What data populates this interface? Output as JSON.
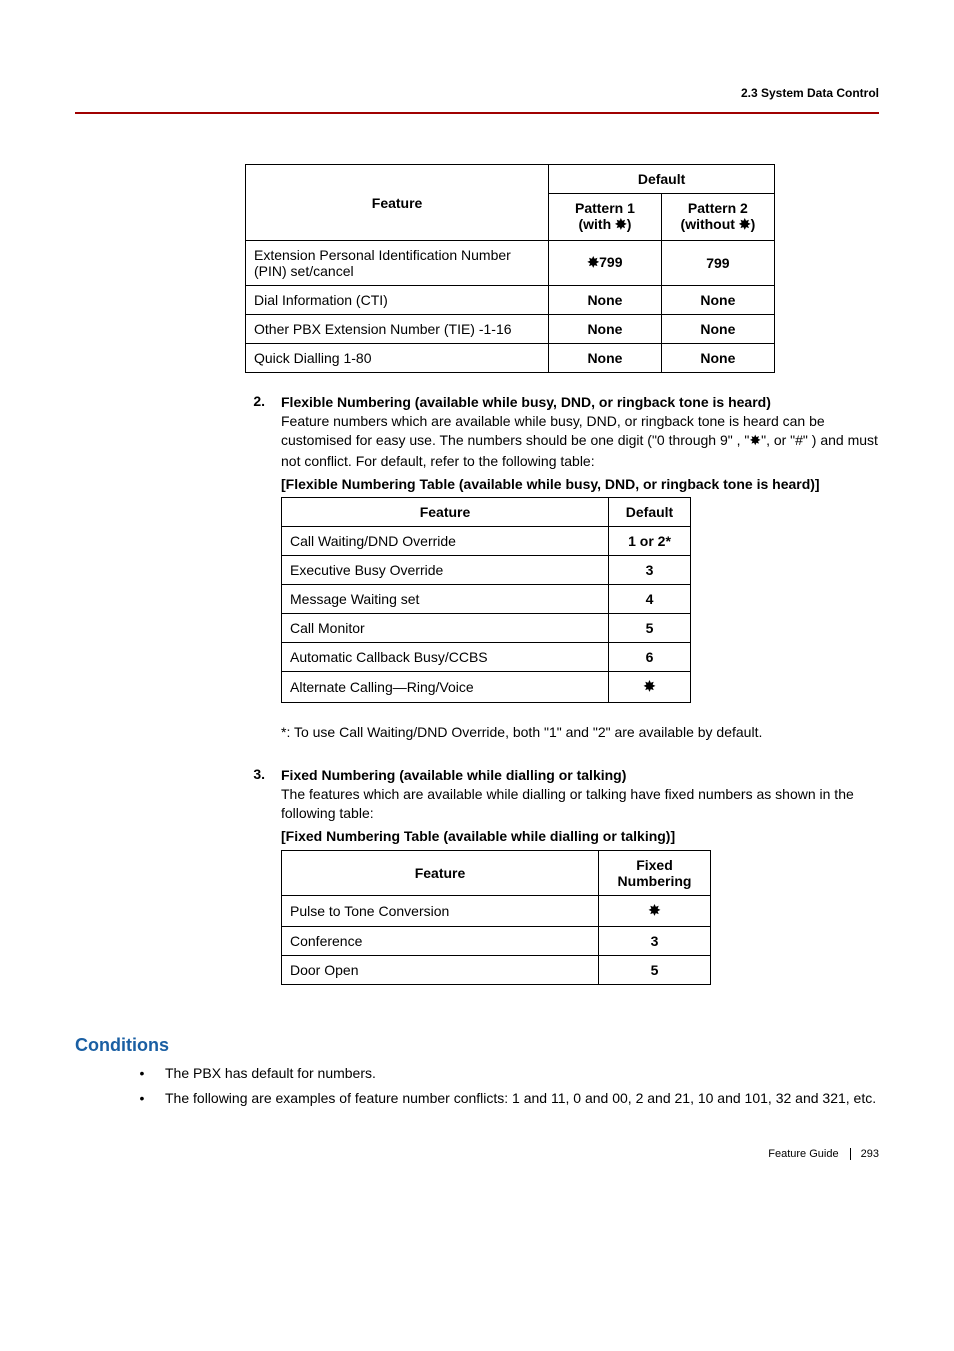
{
  "header": {
    "section": "2.3 System Data Control"
  },
  "table1": {
    "headers": {
      "feature": "Feature",
      "default": "Default",
      "pattern1_line1": "Pattern 1",
      "pattern1_line2": "(with ",
      "pattern1_line3": ")",
      "pattern2_line1": "Pattern 2",
      "pattern2_line2": "(without ",
      "pattern2_line3": ")"
    },
    "rows": [
      {
        "feature": "Extension Personal Identification Number (PIN) set/cancel",
        "p1": "799",
        "p1_star": true,
        "p2": "799"
      },
      {
        "feature": "Dial Information (CTI)",
        "p1": "None",
        "p1_star": false,
        "p2": "None"
      },
      {
        "feature": "Other PBX Extension Number (TIE) -1-16",
        "p1": "None",
        "p1_star": false,
        "p2": "None"
      },
      {
        "feature": "Quick Dialling 1-80",
        "p1": "None",
        "p1_star": false,
        "p2": "None"
      }
    ]
  },
  "item2": {
    "num": "2.",
    "title": "Flexible Numbering (available while busy, DND, or ringback tone is heard)",
    "body1": "Feature numbers which are available while busy, DND, or ringback tone is heard can be customised for easy use. The numbers should be one digit (\"0 through 9\" , \"",
    "body2": "\", or \"#\" ) and must not conflict. For default, refer to the following table:",
    "table_title": "[Flexible Numbering Table (available while busy, DND, or ringback tone is heard)]",
    "headers": {
      "feature": "Feature",
      "default": "Default"
    },
    "rows": [
      {
        "feature": "Call Waiting/DND Override",
        "default": "1 or 2*"
      },
      {
        "feature": "Executive Busy Override",
        "default": "3"
      },
      {
        "feature": "Message Waiting set",
        "default": "4"
      },
      {
        "feature": "Call Monitor",
        "default": "5"
      },
      {
        "feature": "Automatic Callback Busy/CCBS",
        "default": "6"
      },
      {
        "feature": "Alternate Calling—Ring/Voice",
        "default": "★",
        "is_star": true
      }
    ],
    "footnote": "*:   To use Call Waiting/DND Override, both \"1\" and \"2\" are available by default."
  },
  "item3": {
    "num": "3.",
    "title": "Fixed Numbering (available while dialling or talking)",
    "body": "The features which are available while dialling or talking have fixed numbers as shown in the following table:",
    "table_title": "[Fixed Numbering Table (available while dialling or talking)]",
    "headers": {
      "feature": "Feature",
      "fixed": "Fixed Numbering"
    },
    "rows": [
      {
        "feature": "Pulse to Tone Conversion",
        "value": "★",
        "is_star": true
      },
      {
        "feature": "Conference",
        "value": "3"
      },
      {
        "feature": "Door Open",
        "value": "5"
      }
    ]
  },
  "conditions": {
    "title": "Conditions",
    "items": [
      "The PBX has default for numbers.",
      "The following are examples of feature number conflicts: 1 and 11, 0 and 00, 2 and 21, 10 and 101, 32 and 321, etc."
    ]
  },
  "footer": {
    "guide": "Feature Guide",
    "page": "293"
  },
  "chart_data": [
    {
      "type": "table",
      "title": "Feature / Default (Pattern 1 with *, Pattern 2 without *)",
      "columns": [
        "Feature",
        "Pattern 1 (with *)",
        "Pattern 2 (without *)"
      ],
      "rows": [
        [
          "Extension Personal Identification Number (PIN) set/cancel",
          "*799",
          "799"
        ],
        [
          "Dial Information (CTI)",
          "None",
          "None"
        ],
        [
          "Other PBX Extension Number (TIE) -1-16",
          "None",
          "None"
        ],
        [
          "Quick Dialling 1-80",
          "None",
          "None"
        ]
      ]
    },
    {
      "type": "table",
      "title": "Flexible Numbering Table (available while busy, DND, or ringback tone is heard)",
      "columns": [
        "Feature",
        "Default"
      ],
      "rows": [
        [
          "Call Waiting/DND Override",
          "1 or 2*"
        ],
        [
          "Executive Busy Override",
          "3"
        ],
        [
          "Message Waiting set",
          "4"
        ],
        [
          "Call Monitor",
          "5"
        ],
        [
          "Automatic Callback Busy/CCBS",
          "6"
        ],
        [
          "Alternate Calling—Ring/Voice",
          "*"
        ]
      ]
    },
    {
      "type": "table",
      "title": "Fixed Numbering Table (available while dialling or talking)",
      "columns": [
        "Feature",
        "Fixed Numbering"
      ],
      "rows": [
        [
          "Pulse to Tone Conversion",
          "*"
        ],
        [
          "Conference",
          "3"
        ],
        [
          "Door Open",
          "5"
        ]
      ]
    }
  ]
}
